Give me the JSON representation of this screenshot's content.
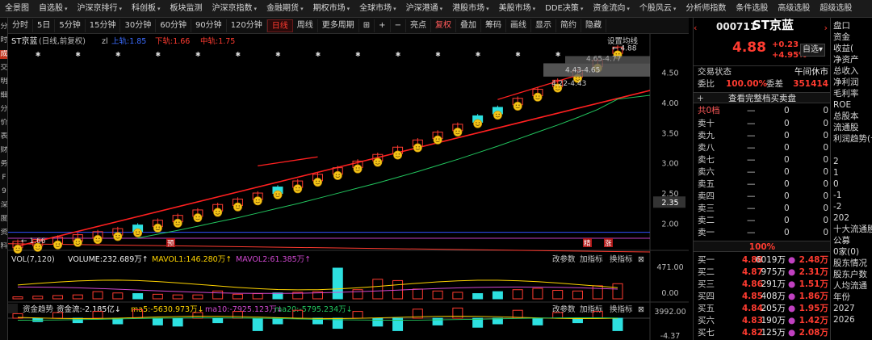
{
  "nav": [
    "全景图",
    "自选股",
    "沪深京排行",
    "科创板",
    "板块监测",
    "沪深京指数",
    "金融期货",
    "期权市场",
    "全球市场",
    "沪深港通",
    "港股市场",
    "美股市场",
    "DDE决策",
    "资金流向",
    "个股风云",
    "分析师指数",
    "条件选股",
    "高级选股",
    "超级选股"
  ],
  "nav_caret": "▾",
  "left_strip": [
    "分",
    "时",
    "成",
    "交",
    "明",
    "细",
    "分",
    "价",
    "表",
    "财",
    "务",
    "F",
    "9",
    "深",
    "度",
    "资",
    "料"
  ],
  "toolbar": {
    "items": [
      "分时",
      "5日",
      "5分钟",
      "15分钟",
      "30分钟",
      "60分钟",
      "90分钟",
      "120分钟",
      "日线",
      "周线",
      "更多周期",
      "⊞",
      "+",
      "−",
      "亮点",
      "复权",
      "叠加",
      "筹码",
      "画线",
      "显示",
      "简约",
      "隐藏"
    ],
    "active": "日线",
    "red": "复权"
  },
  "chart": {
    "header": "ST京蓝",
    "header_sub": "(日线,前复权)",
    "ind_name": "zl",
    "upper_label": "上轨:1.85",
    "lower_label": "下轨:1.66",
    "mid_label": "中轨:1.75",
    "set_ma": "设置均线",
    "y_labels": [
      "4.50",
      "4.00",
      "3.50",
      "3.00",
      "2.50",
      "2.00"
    ],
    "y_values": [
      4.5,
      4.0,
      3.5,
      3.0,
      2.5,
      2.0
    ],
    "current_price": "2.35",
    "annotations": {
      "high": "4.88",
      "low": "1.66",
      "t1": "4.65-4.77",
      "t2": "4.43-4.65",
      "t3": "4.22-4.43",
      "mark1": "预",
      "mark2": "精",
      "mark3": "涨"
    },
    "candles": [
      1.66,
      1.69,
      1.73,
      1.77,
      1.82,
      1.87,
      1.93,
      2.01,
      2.09,
      2.18,
      2.27,
      2.36,
      2.46,
      2.56,
      2.66,
      2.77,
      2.88,
      2.99,
      3.1,
      3.22,
      3.34,
      3.47,
      3.6,
      3.74,
      3.88,
      4.03,
      4.18,
      4.33,
      4.49,
      4.66,
      4.88
    ]
  },
  "vol": {
    "title": "VOL(7,120)",
    "volume": "VOLUME:232.689万↑",
    "mavol1": "MAVOL1:146.280万↑",
    "mavol2": "MAVOL2:61.385万↑",
    "btn_params": "改参数",
    "btn_add": "加指标",
    "btn_switch": "换指标",
    "y_top": "471.00",
    "y_bot": "0.00",
    "values": [
      30,
      40,
      50,
      60,
      110,
      90,
      80,
      70,
      60,
      60,
      120,
      70,
      80,
      90,
      100,
      110,
      471,
      140,
      300,
      280,
      150,
      120,
      100,
      80,
      110,
      140,
      160,
      130,
      120,
      200,
      232
    ]
  },
  "flow": {
    "title": "资金趋势",
    "main": "资金流:-2.185亿↓",
    "ma5": "ma5:-5630.973万↓",
    "ma10": "ma10:-7925.123万↓",
    "ma20": "ma20:-5795.234万↓",
    "y_top": "3992.00",
    "y_bot": "-4.37",
    "values": [
      8,
      -6,
      10,
      -8,
      12,
      -10,
      15,
      -12,
      -14,
      10,
      -8,
      12,
      -22,
      -10,
      14,
      -10,
      -18,
      12,
      -14,
      -22,
      16,
      -12,
      18,
      -16,
      -10,
      14,
      -12,
      10,
      -8,
      12,
      -22
    ]
  },
  "quote": {
    "code": "000711",
    "name": "ST京蓝",
    "price": "4.88",
    "change": "+0.23",
    "change_pct": "+4.95%",
    "watch_btn": "自选",
    "status_label": "交易状态",
    "status_value": "午间休市",
    "weibi_label": "委比",
    "weibi_value": "100.00%",
    "weicha_label": "委差",
    "weicha_value": "351414",
    "full_book": "查看完整档买卖盘",
    "total_label": "共0档",
    "sells": [
      [
        "卖十",
        "—",
        "0",
        "0"
      ],
      [
        "卖九",
        "—",
        "0",
        "0"
      ],
      [
        "卖八",
        "—",
        "0",
        "0"
      ],
      [
        "卖七",
        "—",
        "0",
        "0"
      ],
      [
        "卖六",
        "—",
        "0",
        "0"
      ],
      [
        "卖五",
        "—",
        "0",
        "0"
      ],
      [
        "卖四",
        "—",
        "0",
        "0"
      ],
      [
        "卖三",
        "—",
        "0",
        "0"
      ],
      [
        "卖二",
        "—",
        "0",
        "0"
      ],
      [
        "卖一",
        "—",
        "0",
        "0"
      ]
    ],
    "ratio_bar": "100%",
    "buys": [
      [
        "买一",
        "4.88",
        "6019万",
        "2.48万"
      ],
      [
        "买二",
        "4.87",
        "975万",
        "2.31万"
      ],
      [
        "买三",
        "4.86",
        "291万",
        "1.51万"
      ],
      [
        "买四",
        "4.85",
        "408万",
        "1.86万"
      ],
      [
        "买五",
        "4.84",
        "205万",
        "1.95万"
      ],
      [
        "买六",
        "4.83",
        "190万",
        "1.42万"
      ],
      [
        "买七",
        "4.82",
        "125万",
        "2.08万"
      ]
    ]
  },
  "farright": [
    "盘口",
    "资金",
    "收益(",
    "净资产",
    "总收入",
    "净利润",
    "毛利率",
    "ROE",
    "总股本",
    "流通股",
    "利润趋势(十",
    "",
    "2",
    "1",
    "0",
    "-1",
    "-2",
    "202",
    "十大流通股东",
    "公募",
    "0家(0)",
    "股东情况",
    "股东户数",
    "人均流通",
    "年份",
    "2027",
    "2026"
  ],
  "colors": {
    "up": "#ff3b30",
    "down": "#2de0e0",
    "green": "#23d16b",
    "yellow": "#ffd400",
    "purple": "#d048d0",
    "bg": "#000000"
  }
}
